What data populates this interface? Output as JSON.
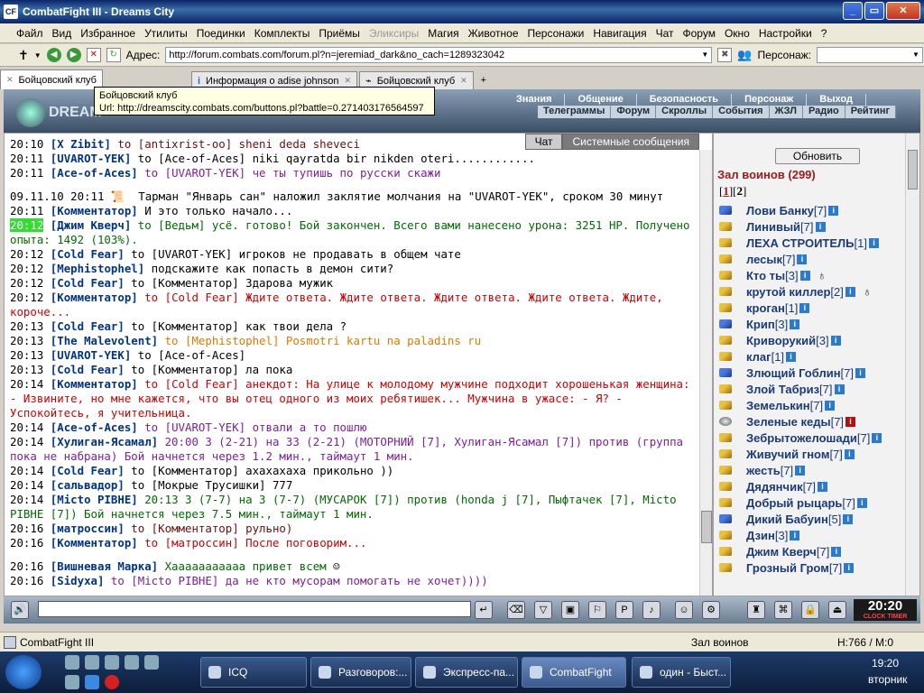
{
  "window": {
    "title": "CombatFight III - Dreams City",
    "icon_label": "CF"
  },
  "menu": [
    "Файл",
    "Вид",
    "Избранное",
    "Утилиты",
    "Поединки",
    "Комплекты",
    "Приёмы",
    "Эликсиры",
    "Магия",
    "Животное",
    "Персонажи",
    "Навигация",
    "Чат",
    "Форум",
    "Окно",
    "Настройки",
    "?"
  ],
  "address": {
    "label": "Адрес:",
    "url": "http://forum.combats.com/forum.pl?n=jeremiad_dark&no_cach=1289323042",
    "persona_label": "Персонаж:"
  },
  "tabs": [
    {
      "label": "Бойцовский клуб"
    },
    {
      "label": "Информация о adise johnson"
    },
    {
      "label": "Бойцовский клуб"
    }
  ],
  "tooltip": {
    "title": "Бойцовский клуб",
    "url": "Url: http://dreamscity.combats.com/buttons.pl?battle=0.271403176564597"
  },
  "game_header": {
    "logo": "DREAM",
    "nav1": [
      "Знания",
      "Общение",
      "Безопасность",
      "Персонаж",
      "Выход"
    ],
    "nav2": [
      "Телеграммы",
      "Форум",
      "Скроллы",
      "События",
      "ЖЗЛ",
      "Радио",
      "Рейтинг"
    ]
  },
  "chat_tabs": {
    "chat": "Чат",
    "system": "Системные сообщения"
  },
  "chat": [
    {
      "t": "20:10",
      "n": "[X Zibit]",
      "to": " to [antixrist-oo]",
      "m": " sheni deda sheveci",
      "c": "sys"
    },
    {
      "t": "20:11",
      "n": "[UVAROT-YEK]",
      "to": " to [Ace-of-Aces]",
      "m": " niki qayratda bir nikden oteri............",
      "c": ""
    },
    {
      "t": "20:11",
      "n": "[Ace-of-Aces]",
      "to": " to [UVAROT-YEK]",
      "m": " че ты тупишь по русски скажи",
      "c": "pur"
    },
    {
      "t": "09.11.10 20:11",
      "n": "",
      "to": "",
      "m": "  Тарман \"Январь сан\" наложил заклятие молчания на \"UVAROT-YEK\", сроком 30 минут",
      "c": "",
      "sp": 1
    },
    {
      "t": "20:11",
      "n": "[Комментатор]",
      "to": "",
      "m": " И это только начало...",
      "c": ""
    },
    {
      "t": "20:12",
      "n": "[Джим Кверч]",
      "to": " to [Ведьм]",
      "m": " усё. готово! Бой закончен. Всего вами нанесено урона: 3251 HP. Получено опыта: 1492 (103%).",
      "c": "grn",
      "hl": 1
    },
    {
      "t": "20:12",
      "n": "[Cold Fear]",
      "to": " to [UVAROT-YEK]",
      "m": " игроков не продавать в общем чате",
      "c": ""
    },
    {
      "t": "20:12",
      "n": "[Mephistophel]",
      "to": "",
      "m": " подскажите как попасть в демон сити?",
      "c": ""
    },
    {
      "t": "20:12",
      "n": "[Cold Fear]",
      "to": " to [Комментатор]",
      "m": " Здарова мужик",
      "c": ""
    },
    {
      "t": "20:12",
      "n": "[Комментатор]",
      "to": " to [Cold Fear]",
      "m": " Ждите ответа. Ждите ответа. Ждите ответа. Ждите ответа. Ждите, короче...",
      "c": "red"
    },
    {
      "t": "20:13",
      "n": "[Cold Fear]",
      "to": " to [Комментатор]",
      "m": " как твои дела ?",
      "c": ""
    },
    {
      "t": "20:13",
      "n": "[The Malevolent]",
      "to": " to [Mephistophel]",
      "m": " Posmotri kartu na paladins ru",
      "c": "org"
    },
    {
      "t": "20:13",
      "n": "[UVAROT-YEK]",
      "to": " to [Ace-of-Aces]",
      "m": "",
      "c": ""
    },
    {
      "t": "20:13",
      "n": "[Cold Fear]",
      "to": " to [Комментатор]",
      "m": " ла пока",
      "c": ""
    },
    {
      "t": "20:14",
      "n": "[Комментатор]",
      "to": " to [Cold Fear]",
      "m": " анекдот: На улице к молодому мужчине подходит хорошенькая женщина: - Извините, но мне кажется, что вы отец одного из моих ребятишек... Мужчина в ужасе: - Я? - Успокойтесь, я учительница.",
      "c": "red"
    },
    {
      "t": "20:14",
      "n": "[Ace-of-Aces]",
      "to": " to [UVAROT-YEK]",
      "m": " отвали а то пошлю",
      "c": "pur"
    },
    {
      "t": "20:14",
      "n": "[Хулиган-Ясамал]",
      "to": "",
      "m": " 20:00 3 (2-21) на 33 (2-21) (МОТОРНИЙ [7], Хулиган-Ясамал [7]) против (группа пока не набрана) Бой начнется через 1.2 мин., таймаут 1 мин.",
      "c": "pur"
    },
    {
      "t": "20:14",
      "n": "[Cold Fear]",
      "to": " to [Комментатор]",
      "m": " ахахахаха прикольно ))",
      "c": ""
    },
    {
      "t": "20:14",
      "n": "[сальвадор]",
      "to": " to [Мокрые Трусишки]",
      "m": " 777",
      "c": ""
    },
    {
      "t": "20:14",
      "n": "[Micto PIBHE]",
      "to": "",
      "m": " 20:13 3 (7-7) на 3 (7-7) (МУСАРОК [7]) против (honda j [7], Пыфтачек [7], Micto PIBHE [7]) Бой начнется через 7.5 мин., таймаут 1 мин.",
      "c": "grn"
    },
    {
      "t": "20:16",
      "n": "[матроссин]",
      "to": " to [Комментатор]",
      "m": " рульно)",
      "c": "sys"
    },
    {
      "t": "20:16",
      "n": "[Комментатор]",
      "to": " to [матроссин]",
      "m": " После поговорим...",
      "c": "red"
    },
    {
      "t": "20:16",
      "n": "[Вишневая Марка]",
      "to": "",
      "m": " Хааааааааааа привет всем",
      "c": "grn",
      "gapb": 1
    },
    {
      "t": "20:16",
      "n": "[Sidyxa]",
      "to": " to [Micto PIBHE]",
      "m": " да не кто мусорам помогать не хочет))))",
      "c": "pur"
    }
  ],
  "room": {
    "refresh": "Обновить",
    "title": "Зал воинов (299)",
    "pages": [
      "1",
      "2"
    ]
  },
  "players": [
    {
      "name": "Лови Банку",
      "lvl": "[7]",
      "ic": "b"
    },
    {
      "name": "Линивый",
      "lvl": "[7]",
      "ic": ""
    },
    {
      "name": "ЛЕХА СТРОИТЕЛЬ",
      "lvl": "[1]",
      "ic": ""
    },
    {
      "name": "лесык",
      "lvl": "[7]",
      "ic": ""
    },
    {
      "name": "Кто ты",
      "lvl": "[3]",
      "ic": "",
      "extra": "♁"
    },
    {
      "name": "крутой киллер",
      "lvl": "[2]",
      "ic": "",
      "extra": "♁"
    },
    {
      "name": "кроган",
      "lvl": "[1]",
      "ic": ""
    },
    {
      "name": "Крип",
      "lvl": "[3]",
      "ic": "b"
    },
    {
      "name": "Криворукий",
      "lvl": "[3]",
      "ic": ""
    },
    {
      "name": "клаг",
      "lvl": "[1]",
      "ic": ""
    },
    {
      "name": "Злющий Гоблин",
      "lvl": "[7]",
      "ic": "b"
    },
    {
      "name": "Злой Табриз",
      "lvl": "[7]",
      "ic": ""
    },
    {
      "name": "Земелькин",
      "lvl": "[7]",
      "ic": ""
    },
    {
      "name": "Зеленые кеды",
      "lvl": "[7]",
      "ic": "sk",
      "red": 1
    },
    {
      "name": "Зебрытожелошади",
      "lvl": "[7]",
      "ic": ""
    },
    {
      "name": "Живучий гном",
      "lvl": "[7]",
      "ic": ""
    },
    {
      "name": "жесть",
      "lvl": "[7]",
      "ic": ""
    },
    {
      "name": "Дядянчик",
      "lvl": "[7]",
      "ic": ""
    },
    {
      "name": "Добрый рыцарь",
      "lvl": "[7]",
      "ic": ""
    },
    {
      "name": "Дикий Бабуин",
      "lvl": "[5]",
      "ic": "b"
    },
    {
      "name": "Дзин",
      "lvl": "[3]",
      "ic": ""
    },
    {
      "name": "Джим Кверч",
      "lvl": "[7]",
      "ic": ""
    },
    {
      "name": "Грозный Гром",
      "lvl": "[7]",
      "ic": ""
    }
  ],
  "clock": {
    "time": "20:20",
    "sub": "CLOCK TIMER"
  },
  "status": {
    "left": "CombatFight III",
    "room": "Зал воинов",
    "coords": "H:766 / M:0"
  },
  "taskbar": {
    "items": [
      "ICQ",
      "Разговоров:...",
      "Экспресс-па...",
      "CombatFight",
      "один - Быст..."
    ],
    "time": "19:20",
    "day": "вторник"
  }
}
